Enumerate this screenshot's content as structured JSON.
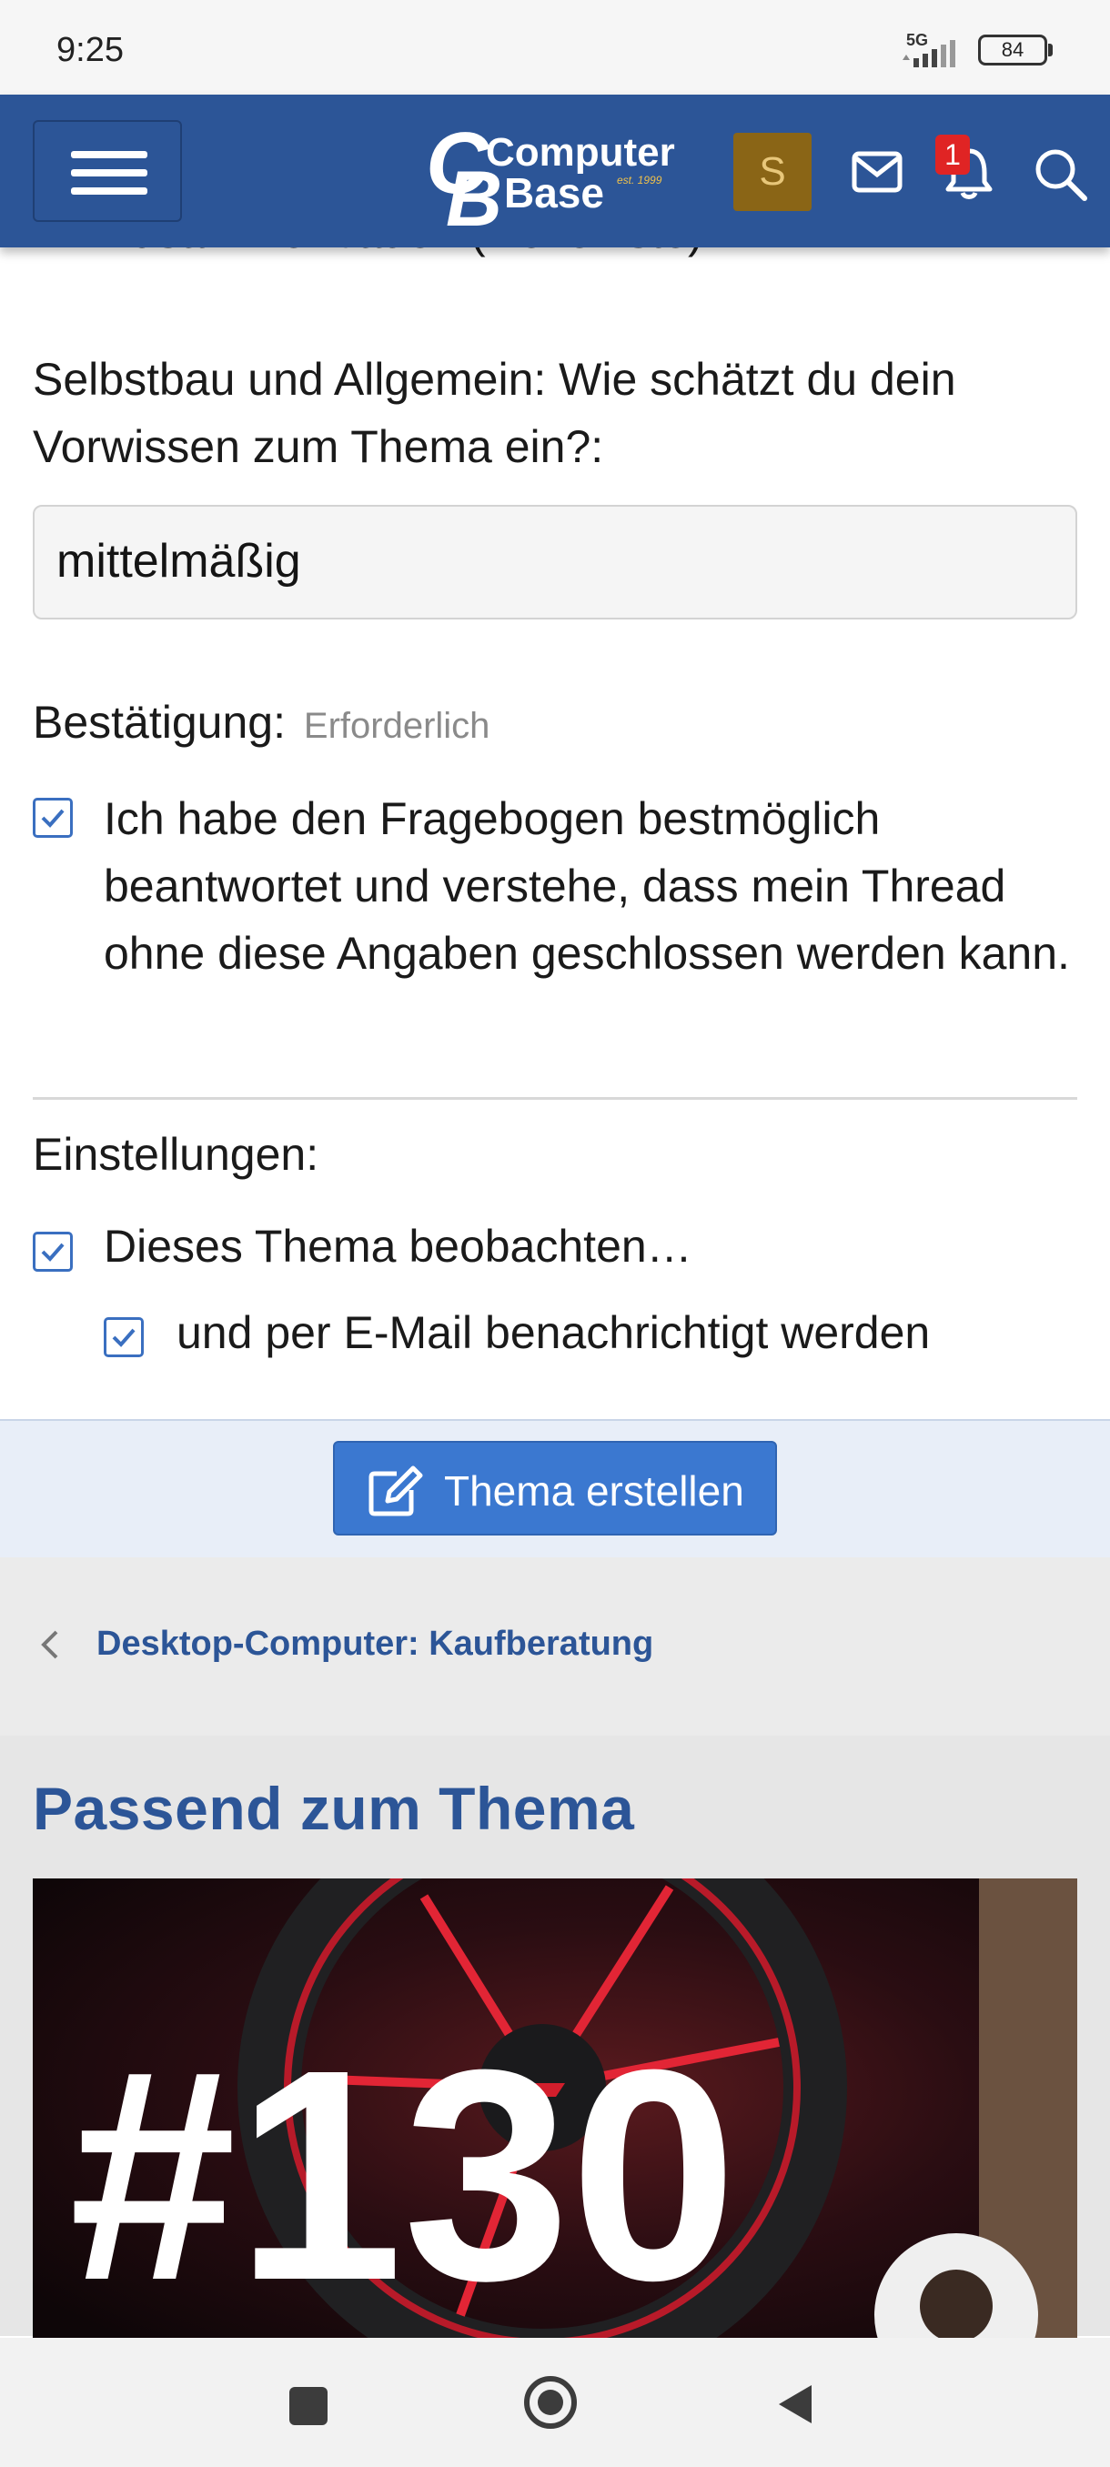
{
  "status_bar": {
    "time": "9:25",
    "network": "5G",
    "battery": "84"
  },
  "header": {
    "logo_top": "Computer",
    "logo_bottom": "Base",
    "logo_est": "est. 1999",
    "avatar_letter": "S",
    "notification_count": "1",
    "brand_color": "#2c5597"
  },
  "form": {
    "cutoff_text": "Zusammenbauen (Helferliste)",
    "question_label": "Selbstbau und Allgemein: Wie schätzt du dein Vorwissen zum Thema ein?:",
    "question_answer": "mittelmäßig",
    "confirmation_label": "Bestätigung:",
    "confirmation_required": "Erforderlich",
    "confirmation_text": "Ich habe den Fragebogen bestmöglich beantwortet und verstehe, dass mein Thread ohne diese Angaben geschlossen werden kann.",
    "settings_label": "Einstellungen:",
    "watch_label": "Dieses Thema beobachten…",
    "email_label": "und per E-Mail benachrichtigt werden",
    "submit_label": "Thema erstellen"
  },
  "breadcrumb": {
    "link": "Desktop-Computer: Kaufberatung"
  },
  "related": {
    "title": "Passend zum Thema",
    "thumbnail_text": "#130"
  }
}
